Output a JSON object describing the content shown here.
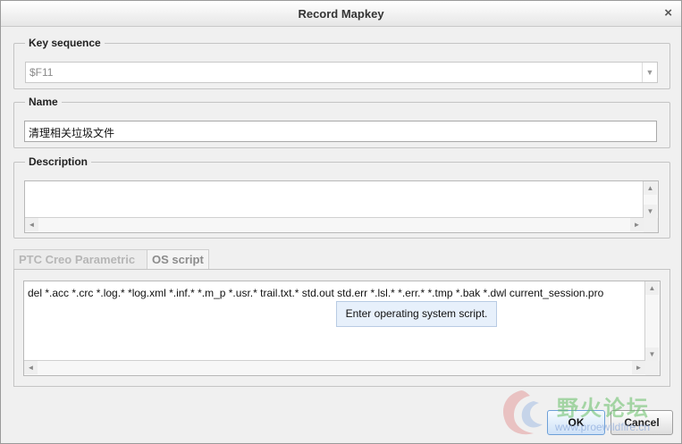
{
  "dialog": {
    "title": "Record Mapkey",
    "close_glyph": "×"
  },
  "key_sequence": {
    "label": "Key sequence",
    "value": "$F11",
    "arrow_glyph": "▼"
  },
  "name": {
    "label": "Name",
    "value": "清理相关垃圾文件"
  },
  "description": {
    "label": "Description",
    "value": ""
  },
  "tabs": [
    {
      "label": "PTC Creo Parametric",
      "active": false
    },
    {
      "label": "OS script",
      "active": true
    }
  ],
  "os_script": {
    "value": "del *.acc *.crc *.log.* *log.xml *.inf.* *.m_p *.usr.* trail.txt.* std.out std.err *.lsl.* *.err.* *.tmp *.bak *.dwl current_session.pro",
    "tooltip": "Enter operating system script."
  },
  "buttons": {
    "ok": "OK",
    "cancel": "Cancel"
  },
  "watermark": {
    "text": "野火论坛",
    "url": "www.proewildfire.cn"
  },
  "scroll_glyphs": {
    "up": "▲",
    "down": "▼",
    "left": "◄",
    "right": "►"
  }
}
